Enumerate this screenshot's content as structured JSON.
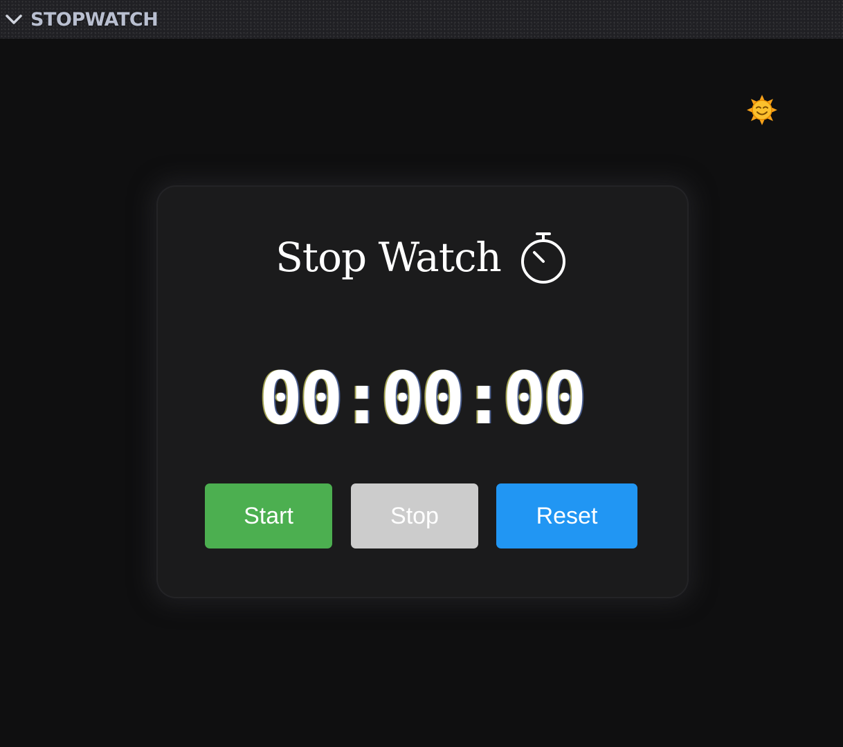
{
  "window": {
    "title": "STOPWATCH",
    "collapse_icon": "chevron-down-icon"
  },
  "theme_toggle": {
    "icon": "sun-face-icon"
  },
  "card": {
    "heading": "Stop Watch",
    "heading_icon": "stopwatch-icon",
    "time": "00:00:00"
  },
  "buttons": {
    "start": "Start",
    "stop": "Stop",
    "reset": "Reset"
  },
  "colors": {
    "start": "#4caf50",
    "stop": "#cccccc",
    "reset": "#2196f3",
    "card": "#1b1b1c",
    "background": "#0f0f10"
  }
}
